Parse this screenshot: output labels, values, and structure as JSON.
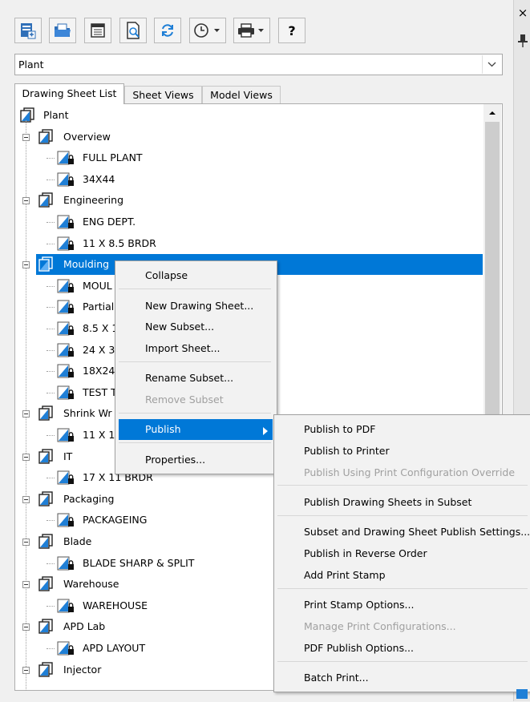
{
  "window": {
    "close_glyph": "×"
  },
  "toolbar": {
    "buttons": [
      {
        "icon": "open-sheet-set-icon"
      },
      {
        "icon": "open-folder-icon"
      },
      {
        "icon": "sheet-list-table-icon"
      },
      {
        "icon": "sheet-preview-icon"
      },
      {
        "icon": "refresh-sync-icon"
      },
      {
        "icon": "clock-history-icon"
      },
      {
        "icon": "printer-icon"
      },
      {
        "icon": "help-icon",
        "label": "?"
      }
    ]
  },
  "combo": {
    "value": "Plant"
  },
  "tabs": [
    {
      "label": "Drawing Sheet List",
      "active": true
    },
    {
      "label": "Sheet Views",
      "active": false
    },
    {
      "label": "Model Views",
      "active": false
    }
  ],
  "tree": {
    "root": "Plant",
    "rows": [
      {
        "label": "Overview",
        "type": "subset"
      },
      {
        "label": "FULL PLANT",
        "type": "sheet"
      },
      {
        "label": "34X44",
        "type": "sheet"
      },
      {
        "label": "Engineering",
        "type": "subset"
      },
      {
        "label": "ENG DEPT.",
        "type": "sheet"
      },
      {
        "label": "11 X 8.5 BRDR",
        "type": "sheet"
      },
      {
        "label": "Moulding",
        "type": "subset",
        "selected": true
      },
      {
        "label": "MOUL",
        "type": "sheet"
      },
      {
        "label": "Partial",
        "type": "sheet"
      },
      {
        "label": "8.5 X 1",
        "type": "sheet"
      },
      {
        "label": "24 X 3",
        "type": "sheet"
      },
      {
        "label": "18X24",
        "type": "sheet"
      },
      {
        "label": "TEST T",
        "type": "sheet"
      },
      {
        "label": "Shrink Wr",
        "type": "subset"
      },
      {
        "label": "11 X 1",
        "type": "sheet"
      },
      {
        "label": "IT",
        "type": "subset"
      },
      {
        "label": "17 X 11 BRDR",
        "type": "sheet"
      },
      {
        "label": "Packaging",
        "type": "subset"
      },
      {
        "label": "PACKAGEING",
        "type": "sheet"
      },
      {
        "label": "Blade",
        "type": "subset"
      },
      {
        "label": "BLADE SHARP & SPLIT",
        "type": "sheet"
      },
      {
        "label": "Warehouse",
        "type": "subset"
      },
      {
        "label": "WAREHOUSE",
        "type": "sheet"
      },
      {
        "label": "APD Lab",
        "type": "subset"
      },
      {
        "label": "APD LAYOUT",
        "type": "sheet"
      },
      {
        "label": "Injector",
        "type": "subset"
      }
    ]
  },
  "context_menu": {
    "items": [
      {
        "label": "Collapse"
      },
      {
        "label": "New Drawing Sheet..."
      },
      {
        "label": "New Subset..."
      },
      {
        "label": "Import Sheet..."
      },
      {
        "label": "Rename Subset..."
      },
      {
        "label": "Remove Subset",
        "disabled": true
      },
      {
        "label": "Publish",
        "highlighted": true,
        "has_submenu": true
      },
      {
        "label": "Properties..."
      }
    ]
  },
  "publish_submenu": {
    "items": [
      {
        "label": "Publish to PDF"
      },
      {
        "label": "Publish to Printer"
      },
      {
        "label": "Publish Using Print Configuration Override",
        "disabled": true
      },
      {
        "label": "Publish Drawing Sheets in Subset"
      },
      {
        "label": "Subset and Drawing Sheet Publish Settings..."
      },
      {
        "label": "Publish in Reverse Order"
      },
      {
        "label": "Add Print Stamp"
      },
      {
        "label": "Print Stamp Options..."
      },
      {
        "label": "Manage Print Configurations...",
        "disabled": true
      },
      {
        "label": "PDF Publish Options..."
      },
      {
        "label": "Batch Print..."
      }
    ]
  },
  "colors": {
    "selection": "#0078d7",
    "icon_blue": "#1f7fd6",
    "disabled_text": "#a0a0a0"
  }
}
